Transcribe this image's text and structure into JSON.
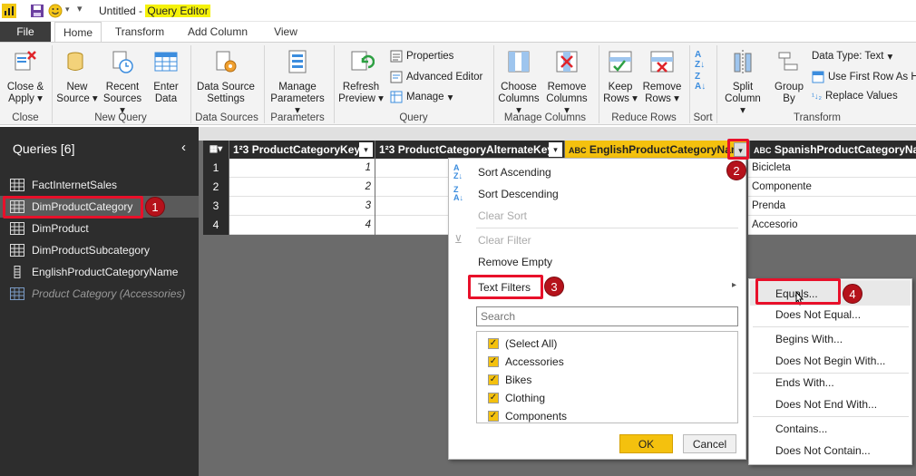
{
  "title_bar": {
    "doc_name": "Untitled - ",
    "app_name": "Query Editor"
  },
  "tabs": [
    "File",
    "Home",
    "Transform",
    "Add Column",
    "View"
  ],
  "ribbon": {
    "close_apply": "Close &",
    "close_apply2": "Apply",
    "new_source": "New",
    "new_source2": "Source",
    "recent_sources": "Recent",
    "recent_sources2": "Sources",
    "enter_data": "Enter",
    "enter_data2": "Data",
    "ds_settings": "Data Source",
    "ds_settings2": "Settings",
    "manage_params": "Manage",
    "manage_params2": "Parameters",
    "refresh": "Refresh",
    "refresh2": "Preview",
    "properties": "Properties",
    "advanced_editor": "Advanced Editor",
    "manage": "Manage",
    "choose_cols": "Choose",
    "choose_cols2": "Columns",
    "remove_cols": "Remove",
    "remove_cols2": "Columns",
    "keep_rows": "Keep",
    "keep_rows2": "Rows",
    "remove_rows": "Remove",
    "remove_rows2": "Rows",
    "split_col": "Split",
    "split_col2": "Column",
    "group_by": "Group",
    "group_by2": "By",
    "data_type": "Data Type: Text",
    "use_first_row": "Use First Row As H",
    "replace_values": "Replace Values",
    "groups": {
      "close": "Close",
      "new_query": "New Query",
      "data_sources": "Data Sources",
      "parameters": "Parameters",
      "query": "Query",
      "manage_columns": "Manage Columns",
      "reduce_rows": "Reduce Rows",
      "sort": "Sort",
      "transform": "Transform"
    }
  },
  "queries": {
    "title": "Queries [6]",
    "items": [
      {
        "label": "FactInternetSales"
      },
      {
        "label": "DimProductCategory"
      },
      {
        "label": "DimProduct"
      },
      {
        "label": "DimProductSubcategory"
      },
      {
        "label": "EnglishProductCategoryName"
      },
      {
        "label": "Product Category (Accessories)"
      }
    ]
  },
  "grid": {
    "columns": [
      {
        "type": "1²3",
        "name": "ProductCategoryKey"
      },
      {
        "type": "1²3",
        "name": "ProductCategoryAlternateKey"
      },
      {
        "type": "ABC",
        "name": "EnglishProductCategoryName"
      },
      {
        "type": "ABC",
        "name": "SpanishProductCategoryName"
      }
    ],
    "row_numbers": [
      "1",
      "2",
      "3",
      "4"
    ],
    "key_values": [
      "1",
      "2",
      "3",
      "4"
    ],
    "spanish_values": [
      "Bicicleta",
      "Componente",
      "Prenda",
      "Accesorio"
    ]
  },
  "filter_menu": {
    "sort_asc": "Sort Ascending",
    "sort_desc": "Sort Descending",
    "clear_sort": "Clear Sort",
    "clear_filter": "Clear Filter",
    "remove_empty": "Remove Empty",
    "text_filters": "Text Filters",
    "search_placeholder": "Search",
    "values": [
      "(Select All)",
      "Accessories",
      "Bikes",
      "Clothing",
      "Components"
    ],
    "ok": "OK",
    "cancel": "Cancel"
  },
  "text_filters_submenu": [
    "Equals...",
    "Does Not Equal...",
    "Begins With...",
    "Does Not Begin With...",
    "Ends With...",
    "Does Not End With...",
    "Contains...",
    "Does Not Contain..."
  ],
  "callouts": [
    "1",
    "2",
    "3",
    "4"
  ],
  "colors": {
    "accent": "#f4c10e",
    "callout_red": "#e8102a",
    "sidebar": "#2d2d2d"
  }
}
